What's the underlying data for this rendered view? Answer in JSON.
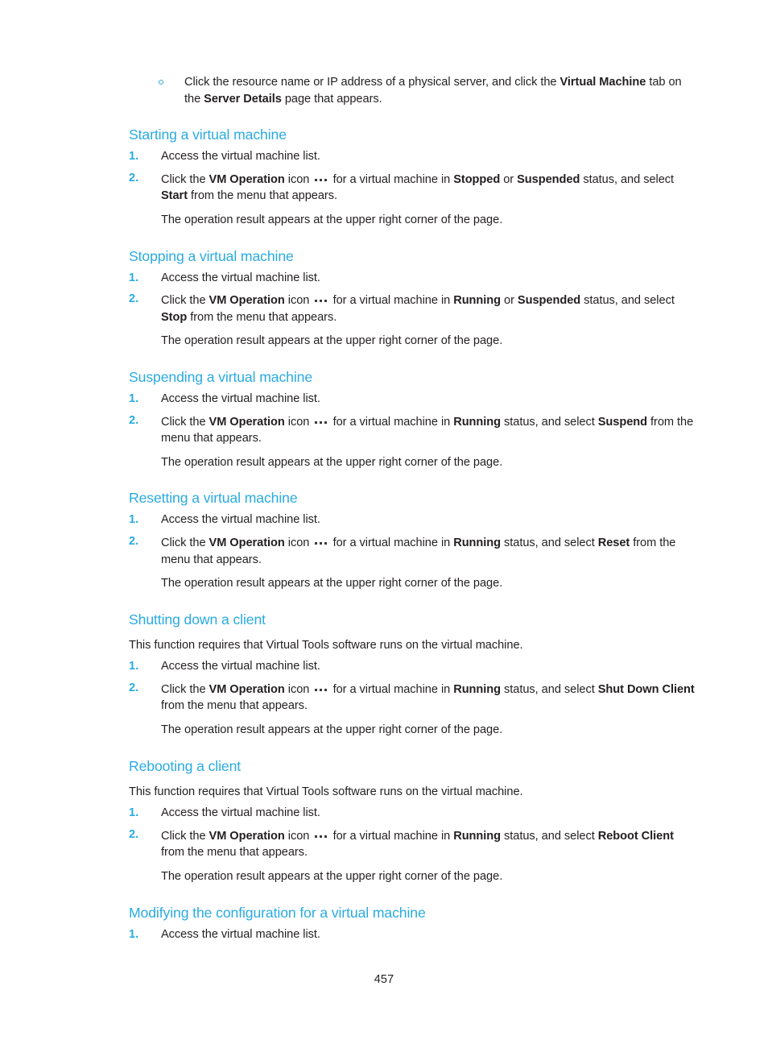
{
  "document": {
    "page_number": "457",
    "accent_color": "#29abe2",
    "text_color": "#231f20"
  },
  "intro_bullet": {
    "marker": "circle-outline-bullet",
    "seg1": "Click the resource name or IP address of a physical server, and click the ",
    "bold1": "Virtual Machine",
    "seg2": " tab on the ",
    "bold2": "Server Details",
    "seg3": " page that appears."
  },
  "common": {
    "step1": "Access the virtual machine list.",
    "result_note": "The operation result appears at the upper right corner of the page.",
    "virtual_tools_note": "This function requires that Virtual Tools software runs on the virtual machine.",
    "num1": "1.",
    "num2": "2.",
    "click_the": "Click the ",
    "vm_operation": "VM Operation",
    "icon_word": " icon ",
    "icon_name": "vm-operation-dots-icon"
  },
  "sections": [
    {
      "id": "starting",
      "heading": "Starting a virtual machine",
      "step2": {
        "seg_for": " for a virtual machine in ",
        "status1": "Stopped",
        "conj": " or ",
        "status2": "Suspended",
        "seg_mid": " status, and select ",
        "action": "Start",
        "seg_end": " from the menu that appears."
      }
    },
    {
      "id": "stopping",
      "heading": "Stopping a virtual machine",
      "step2": {
        "seg_for": " for a virtual machine in ",
        "status1": "Running",
        "conj": " or ",
        "status2": "Suspended",
        "seg_mid": " status, and select ",
        "action": "Stop",
        "seg_end": " from the menu that appears."
      }
    },
    {
      "id": "suspending",
      "heading": "Suspending a virtual machine",
      "step2": {
        "seg_for": " for a virtual machine in ",
        "status1": "Running",
        "conj": "",
        "status2": "",
        "seg_mid": " status, and select ",
        "action": "Suspend",
        "seg_end": " from the menu that appears."
      }
    },
    {
      "id": "resetting",
      "heading": "Resetting a virtual machine",
      "step2": {
        "seg_for": " for a virtual machine in ",
        "status1": "Running",
        "conj": "",
        "status2": "",
        "seg_mid": " status, and select ",
        "action": "Reset",
        "seg_end": " from the menu that appears."
      }
    },
    {
      "id": "shutting-down-client",
      "heading": "Shutting down a client",
      "has_intro": true,
      "step2": {
        "seg_for": " for a virtual machine in ",
        "status1": "Running",
        "conj": "",
        "status2": "",
        "seg_mid": " status, and select ",
        "action": "Shut Down Client",
        "seg_end": " from the menu that appears."
      }
    },
    {
      "id": "rebooting-client",
      "heading": "Rebooting a client",
      "has_intro": true,
      "step2": {
        "seg_for": " for a virtual machine in ",
        "status1": "Running",
        "conj": "",
        "status2": "",
        "seg_mid": " status, and select ",
        "action": "Reboot Client",
        "seg_end": " from the menu that appears."
      }
    },
    {
      "id": "modifying-configuration",
      "heading": "Modifying the configuration for a virtual machine",
      "only_step1": true
    }
  ]
}
